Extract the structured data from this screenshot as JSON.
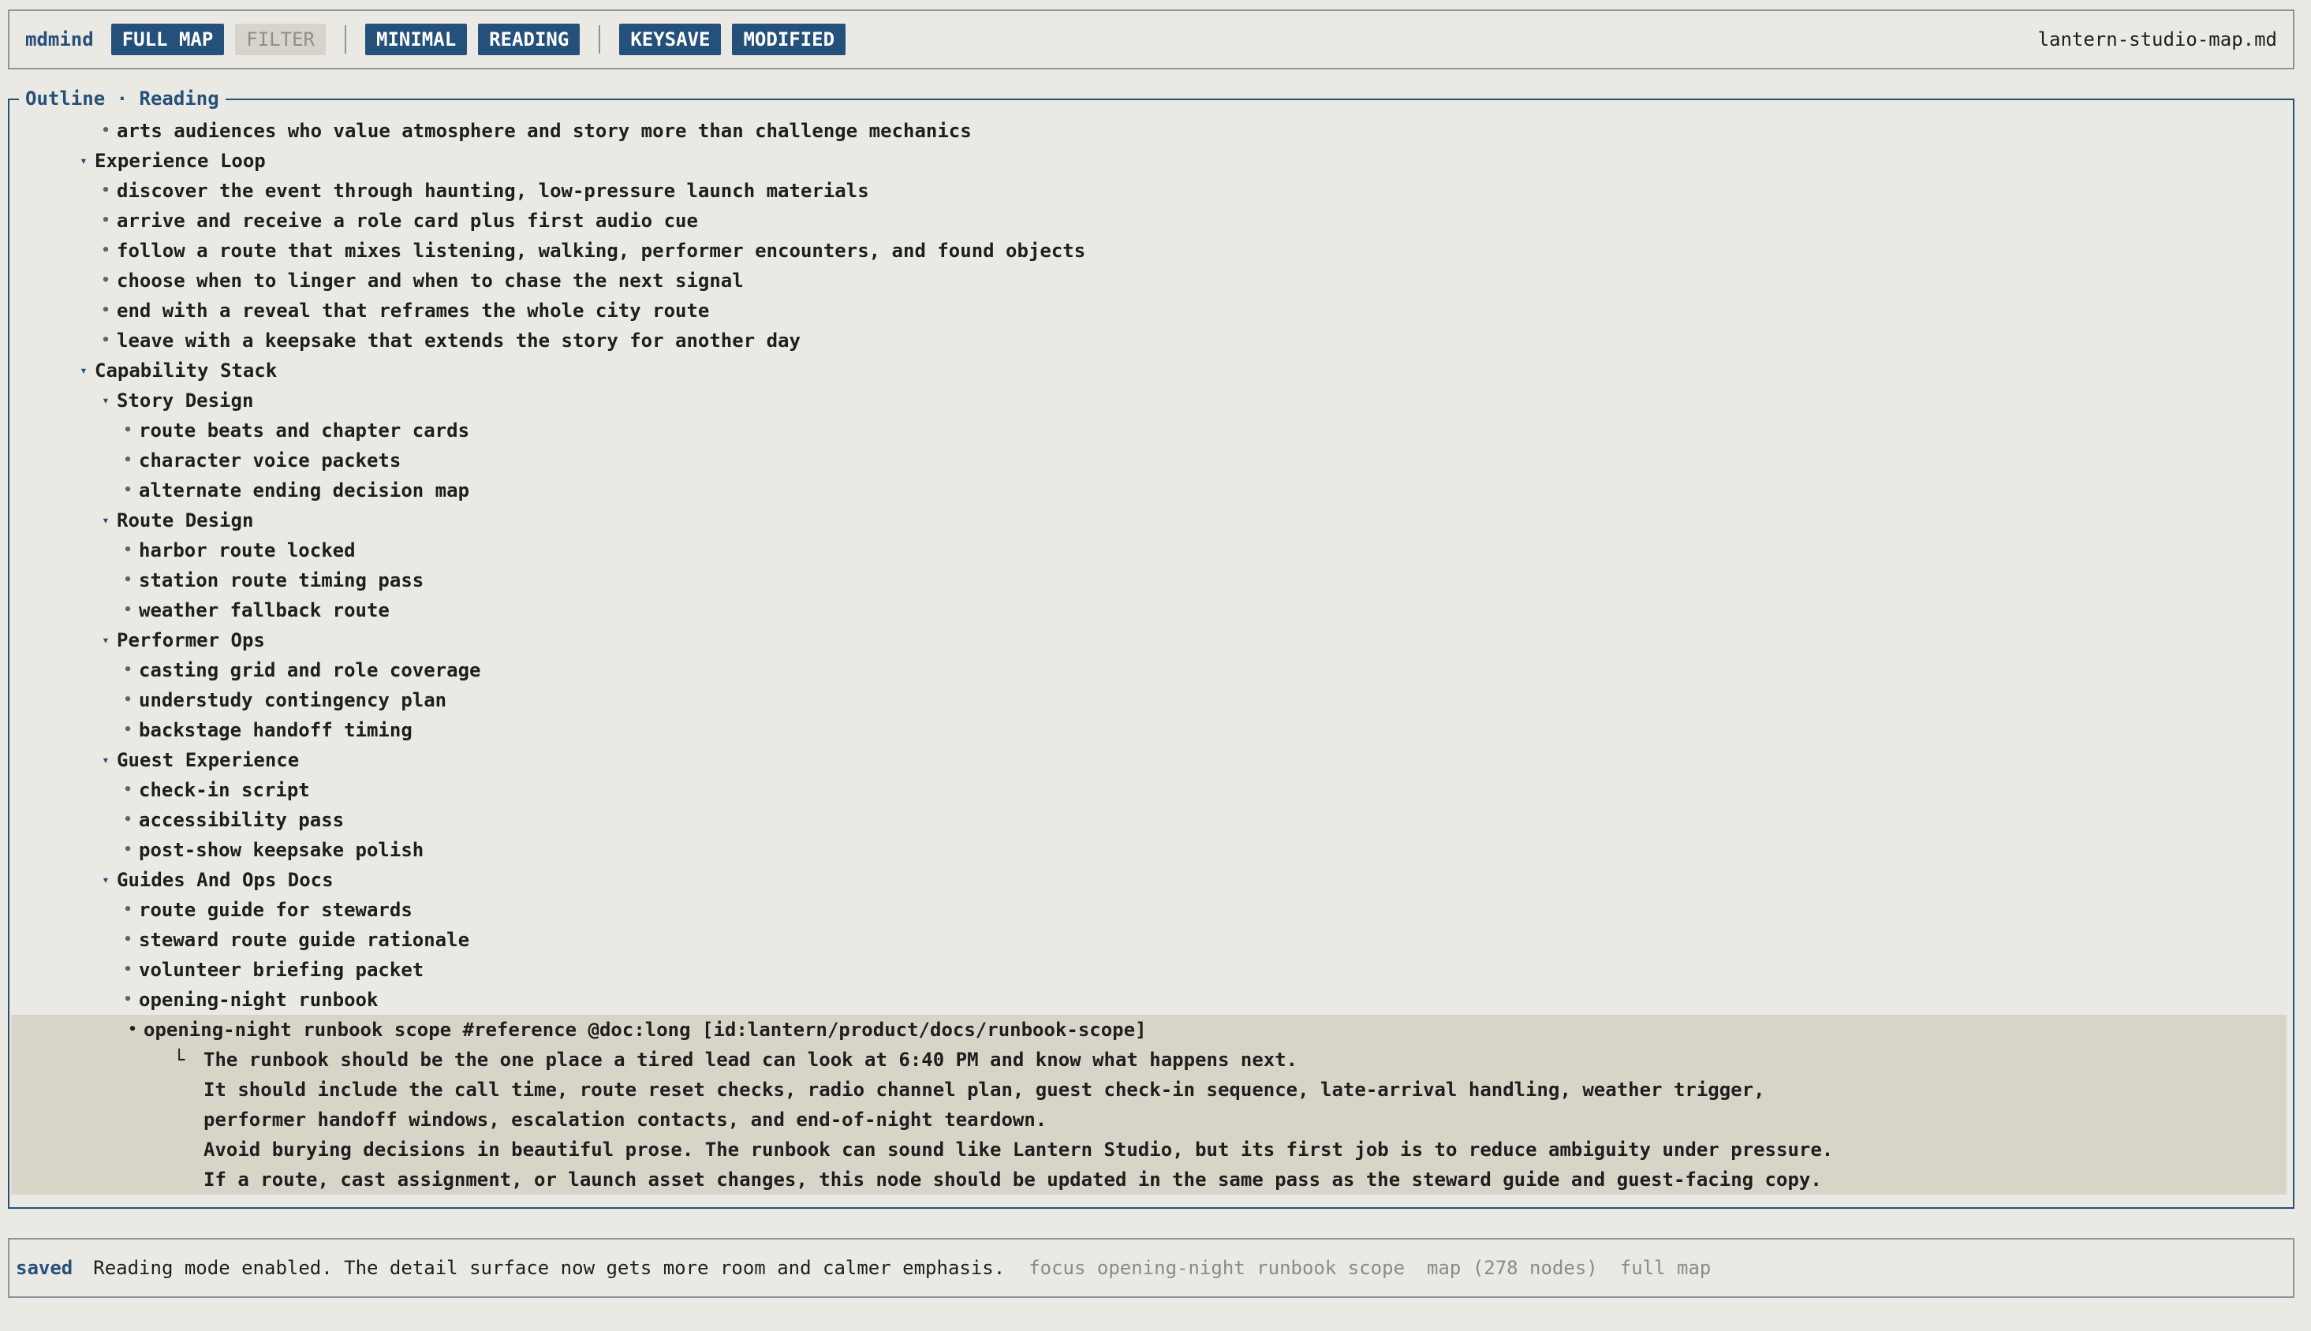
{
  "topbar": {
    "app_name": "mdmind",
    "badges": {
      "full_map": "FULL MAP",
      "filter": "FILTER",
      "minimal": "MINIMAL",
      "reading": "READING",
      "keysave": "KEYSAVE",
      "modified": "MODIFIED"
    },
    "filename": "lantern-studio-map.md"
  },
  "outline": {
    "title": "Outline · Reading",
    "rows": [
      {
        "level": 1,
        "kind": "bullet",
        "text": "arts audiences who value atmosphere and story more than challenge mechanics"
      },
      {
        "level": 0,
        "kind": "group",
        "text": "Experience Loop"
      },
      {
        "level": 1,
        "kind": "bullet",
        "text": "discover the event through haunting, low-pressure launch materials"
      },
      {
        "level": 1,
        "kind": "bullet",
        "text": "arrive and receive a role card plus first audio cue"
      },
      {
        "level": 1,
        "kind": "bullet",
        "text": "follow a route that mixes listening, walking, performer encounters, and found objects"
      },
      {
        "level": 1,
        "kind": "bullet",
        "text": "choose when to linger and when to chase the next signal"
      },
      {
        "level": 1,
        "kind": "bullet",
        "text": "end with a reveal that reframes the whole city route"
      },
      {
        "level": 1,
        "kind": "bullet",
        "text": "leave with a keepsake that extends the story for another day"
      },
      {
        "level": 0,
        "kind": "group",
        "text": "Capability Stack"
      },
      {
        "level": 1,
        "kind": "group",
        "text": "Story Design"
      },
      {
        "level": 2,
        "kind": "bullet",
        "text": "route beats and chapter cards"
      },
      {
        "level": 2,
        "kind": "bullet",
        "text": "character voice packets"
      },
      {
        "level": 2,
        "kind": "bullet",
        "text": "alternate ending decision map"
      },
      {
        "level": 1,
        "kind": "group",
        "text": "Route Design"
      },
      {
        "level": 2,
        "kind": "bullet",
        "text": "harbor route locked"
      },
      {
        "level": 2,
        "kind": "bullet",
        "text": "station route timing pass"
      },
      {
        "level": 2,
        "kind": "bullet",
        "text": "weather fallback route"
      },
      {
        "level": 1,
        "kind": "group",
        "text": "Performer Ops"
      },
      {
        "level": 2,
        "kind": "bullet",
        "text": "casting grid and role coverage"
      },
      {
        "level": 2,
        "kind": "bullet",
        "text": "understudy contingency plan"
      },
      {
        "level": 2,
        "kind": "bullet",
        "text": "backstage handoff timing"
      },
      {
        "level": 1,
        "kind": "group",
        "text": "Guest Experience"
      },
      {
        "level": 2,
        "kind": "bullet",
        "text": "check-in script"
      },
      {
        "level": 2,
        "kind": "bullet",
        "text": "accessibility pass"
      },
      {
        "level": 2,
        "kind": "bullet",
        "text": "post-show keepsake polish"
      },
      {
        "level": 1,
        "kind": "group",
        "text": "Guides And Ops Docs"
      },
      {
        "level": 2,
        "kind": "bullet",
        "text": "route guide for stewards"
      },
      {
        "level": 2,
        "kind": "bullet",
        "text": "steward route guide rationale"
      },
      {
        "level": 2,
        "kind": "bullet",
        "text": "volunteer briefing packet"
      },
      {
        "level": 2,
        "kind": "bullet",
        "text": "opening-night runbook"
      }
    ],
    "selected": {
      "text": "opening-night runbook scope #reference @doc:long [id:lantern/product/docs/runbook-scope]",
      "branch_glyph": "└",
      "detail_lines": [
        "The runbook should be the one place a tired lead can look at 6:40 PM and know what happens next.",
        "It should include the call time, route reset checks, radio channel plan, guest check-in sequence, late-arrival handling, weather trigger,",
        "performer handoff windows, escalation contacts, and end-of-night teardown.",
        "Avoid burying decisions in beautiful prose. The runbook can sound like Lantern Studio, but its first job is to reduce ambiguity under pressure.",
        "If a route, cast assignment, or launch asset changes, this node should be updated in the same pass as the steward guide and guest-facing copy."
      ]
    }
  },
  "statusbar": {
    "saved": "saved",
    "message": "Reading mode enabled. The detail surface now gets more room and calmer emphasis.",
    "focus": "focus opening-night runbook scope",
    "map_count": "map (278 nodes)",
    "view": "full map"
  },
  "icons": {
    "bullet": "•",
    "expanded": "▾"
  },
  "colors": {
    "accent": "#24507a",
    "background": "#ebe9e4",
    "selection": "#d8d4c8"
  }
}
